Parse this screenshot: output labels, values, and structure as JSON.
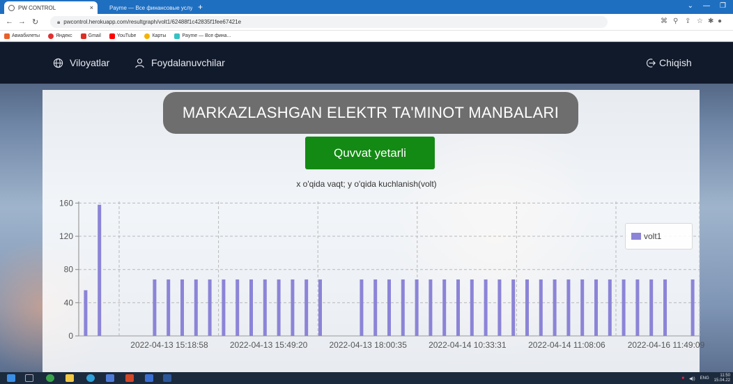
{
  "browser": {
    "tabs": [
      {
        "title": "PW CONTROL",
        "close": "×"
      },
      {
        "title": "Payme — Все финансовые услу",
        "close": "×"
      }
    ],
    "new_tab": "+",
    "url": "pwcontrol.herokuapp.com/resultgraph/volt1/62488f1c42835f1fee67421e",
    "bookmarks": [
      "Авиабилеты",
      "Яндекс",
      "Gmail",
      "YouTube",
      "Карты",
      "Payme — Все фина..."
    ]
  },
  "nav": {
    "regions": "Viloyatlar",
    "users": "Foydalanuvchilar",
    "logout": "Chiqish"
  },
  "main": {
    "title": "MARKAZLASHGAN ELEKTR TA'MINOT MANBALARI",
    "status": "Quvvat yetarli",
    "status_color": "#138a13",
    "caption": "x o'qida vaqt; y o'qida kuchlanish(volt)"
  },
  "chart_data": {
    "type": "bar",
    "series": [
      {
        "name": "volt1",
        "values": [
          55,
          158,
          0,
          0,
          0,
          68,
          68,
          68,
          68,
          68,
          68,
          68,
          68,
          68,
          68,
          68,
          68,
          68,
          0,
          0,
          68,
          68,
          68,
          68,
          68,
          68,
          68,
          68,
          68,
          68,
          68,
          68,
          68,
          68,
          68,
          68,
          68,
          68,
          68,
          68,
          68,
          68,
          68,
          0,
          68
        ]
      }
    ],
    "x_tick_labels": [
      "2022-04-13 15:18:58",
      "2022-04-13 15:49:20",
      "2022-04-13 18:00:35",
      "2022-04-14 10:33:31",
      "2022-04-14 11:08:06",
      "2022-04-16 11:49:09"
    ],
    "y_ticks": [
      0,
      40,
      80,
      120,
      160
    ],
    "ylim": [
      0,
      162
    ],
    "bar_color": "#8b84d7",
    "grid": true,
    "legend_position": "right"
  },
  "taskbar": {
    "lang": "ENG",
    "time": "11:50",
    "date": "15.04.22"
  }
}
